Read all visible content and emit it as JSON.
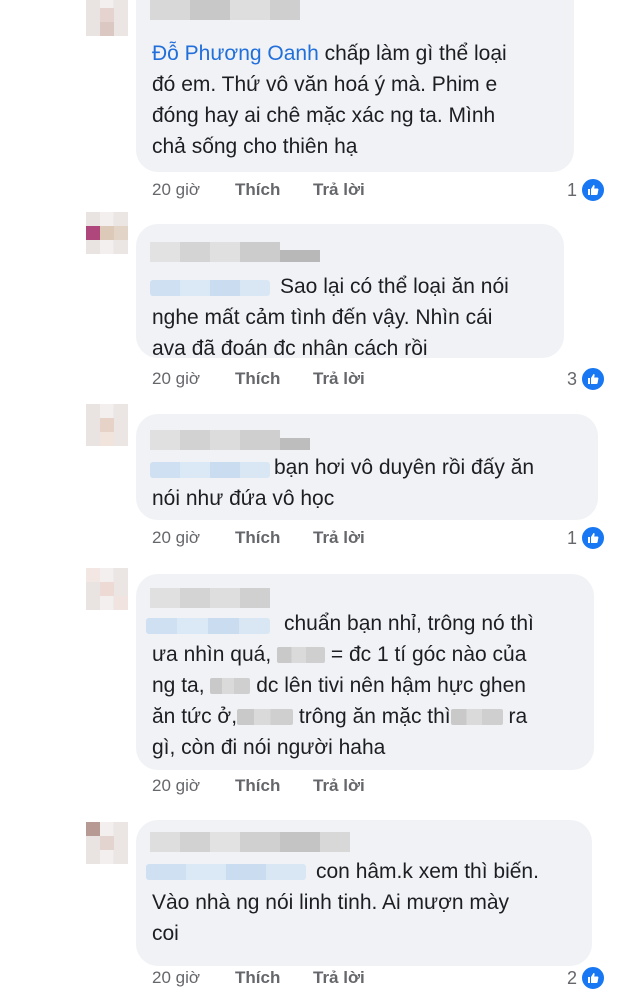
{
  "comments": [
    {
      "mention": "Đỗ Phương Oanh",
      "lines": [
        " chấp làm gì thể loại",
        "đó em. Thứ vô văn hoá ý mà. Phim e",
        "đóng hay ai chê mặc xác ng ta. Mình",
        "chả sống cho thiên hạ"
      ],
      "time": "20 giờ",
      "like_label": "Thích",
      "reply_label": "Trả lời",
      "reactions": "1",
      "reaction_icon": "like-icon"
    },
    {
      "lines": [
        "Sao lại có thể loại ăn nói",
        "nghe mất cảm tình đến vậy. Nhìn cái",
        "ava đã đoán đc nhân cách rồi"
      ],
      "time": "20 giờ",
      "like_label": "Thích",
      "reply_label": "Trả lời",
      "reactions": "3",
      "reaction_icon": "like-icon"
    },
    {
      "lines": [
        "bạn hơi vô duyên rồi đấy ăn",
        "nói như đứa vô học"
      ],
      "time": "20 giờ",
      "like_label": "Thích",
      "reply_label": "Trả lời",
      "reactions": "1",
      "reaction_icon": "like-icon"
    },
    {
      "lines": [
        "chuẩn bạn nhỉ, trông nó thì",
        "ưa nhìn quá,",
        "= đc 1 tí góc nào của",
        "ng ta,",
        "dc lên tivi nên hậm hực ghen",
        "ăn tức ở,",
        "trông ăn mặc thì",
        "ra",
        "gì, còn đi nói người haha"
      ],
      "time": "20 giờ",
      "like_label": "Thích",
      "reply_label": "Trả lời"
    },
    {
      "lines": [
        "con hâm.k xem thì biến.",
        "Vào nhà ng nói linh tinh. Ai mượn mày",
        "coi"
      ],
      "time": "20 giờ",
      "like_label": "Thích",
      "reply_label": "Trả lời",
      "reactions": "2",
      "reaction_icon": "like-icon"
    }
  ],
  "colors": {
    "bubble": "#f0f2f5",
    "mention": "#216fdb",
    "meta": "#65676b",
    "like_badge": "#1877f2"
  }
}
